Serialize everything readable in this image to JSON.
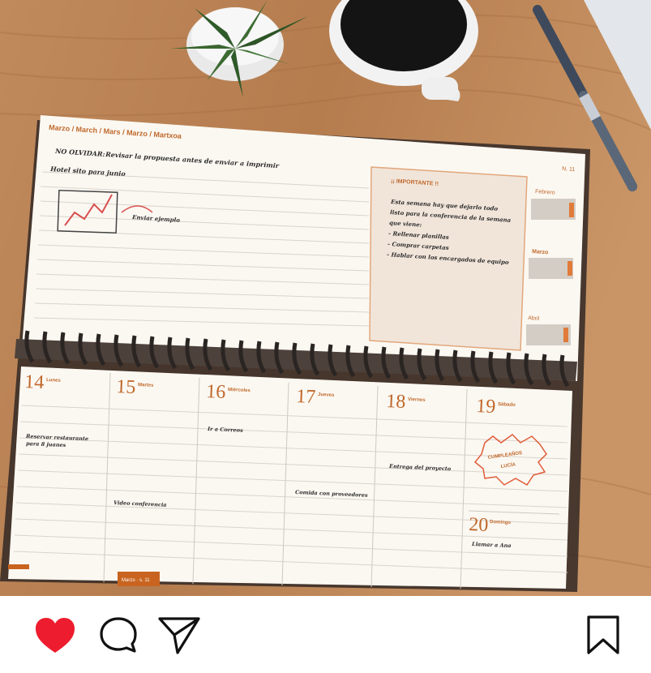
{
  "planner": {
    "month_header": "Marzo / March / Mars / Marzo / Martxoa",
    "page_number": "N. 11",
    "no_olvidar": "NO OLVIDAR:",
    "reminder": "Revisar la propuesta antes de enviar a imprimir",
    "note_hotel": "Hotel sito para junio",
    "chart_note": "Enviar ejemplo",
    "important_title": "¡¡ IMPORTANTE !!",
    "important_lines": [
      "Esta semana hay que dejarlo todo",
      "listo para la conferencia de la semana",
      "que viene:",
      "- Rellenar planillas",
      "- Comprar carpetas",
      "- Hablar con los encargados de equipo"
    ],
    "mini_calendars": [
      "Febrero",
      "Marzo",
      "Abril"
    ],
    "days": [
      {
        "num": "14",
        "name": "Lunes"
      },
      {
        "num": "15",
        "name": "Martes"
      },
      {
        "num": "16",
        "name": "Miércoles"
      },
      {
        "num": "17",
        "name": "Jueves"
      },
      {
        "num": "18",
        "name": "Viernes"
      },
      {
        "num": "19",
        "name": "Sábado"
      },
      {
        "num": "20",
        "name": "Domingo"
      }
    ],
    "entries": {
      "lunes": [
        "Reservar restaurante",
        "para 8 juanes"
      ],
      "martes": "Video conferencia",
      "miercoles": "Ir a Correos",
      "jueves": "Comida con proveedores",
      "viernes": "Entrega del proyecto",
      "sabado_stamp": [
        "CUMPLEAÑOS",
        "LUCÍA"
      ],
      "domingo": "Llamar a Ana"
    },
    "footer_tab": "Marzo · s. 11"
  },
  "actions": {
    "like_color": "#ed1c2e",
    "icons": [
      "heart-icon",
      "comment-icon",
      "share-icon",
      "bookmark-icon"
    ]
  }
}
